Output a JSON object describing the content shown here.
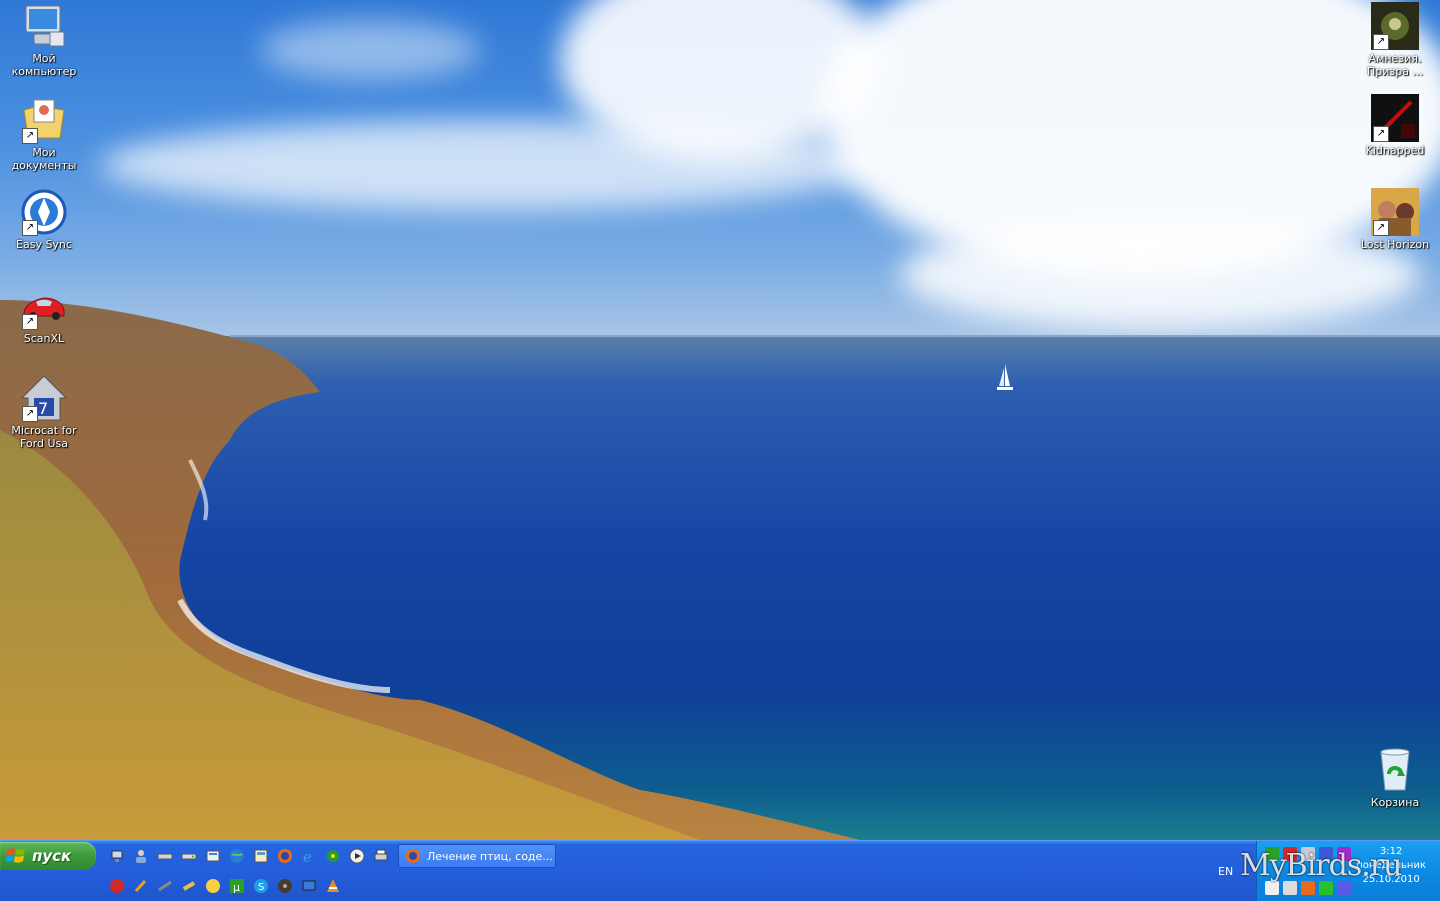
{
  "desktop": {
    "left_icons": [
      {
        "label": "Мой компьютер",
        "icon": "my-computer-icon",
        "shortcut": false
      },
      {
        "label": "Мои документы",
        "icon": "my-documents-icon",
        "shortcut": true
      },
      {
        "label": "Easy Sync",
        "icon": "easy-sync-icon",
        "shortcut": true
      },
      {
        "label": "ScanXL",
        "icon": "red-car-icon",
        "shortcut": true
      },
      {
        "label": "Microcat for Ford Usa",
        "icon": "microcat-icon",
        "shortcut": true
      }
    ],
    "right_icons": [
      {
        "label": "Амнезия. Призра ...",
        "icon": "amnesia-game-icon",
        "shortcut": true
      },
      {
        "label": "Kidnapped",
        "icon": "kidnapped-game-icon",
        "shortcut": true
      },
      {
        "label": "Lost Horizon",
        "icon": "lost-horizon-game-icon",
        "shortcut": true
      },
      {
        "label": "Корзина",
        "icon": "recycle-bin-icon",
        "shortcut": false
      }
    ]
  },
  "taskbar": {
    "start_label": "пуск",
    "task_button_label": "Лечение птиц, соде...",
    "language": "EN",
    "clock_time": "3:12",
    "clock_day": "понедельник",
    "clock_date": "25.10.2010",
    "watermark": "MyBirds.ru"
  },
  "colors": {
    "taskbar_blue": "#245edb",
    "start_green": "#3c9a3a",
    "tray_blue": "#0c8ae4"
  }
}
